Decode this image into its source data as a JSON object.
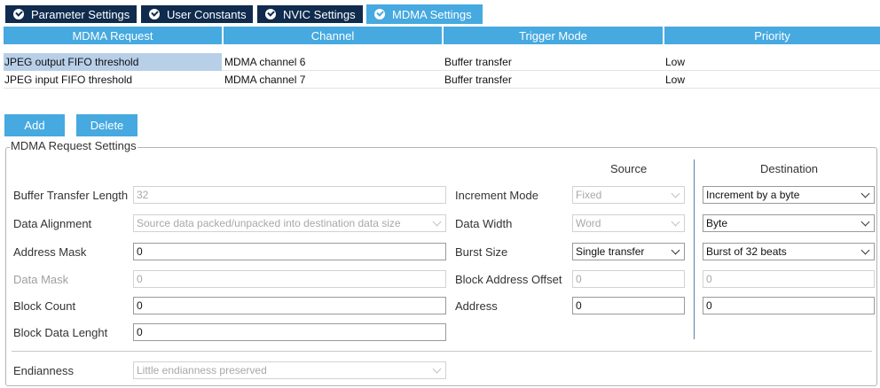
{
  "tabs": [
    {
      "label": "Parameter Settings"
    },
    {
      "label": "User Constants"
    },
    {
      "label": "NVIC Settings"
    },
    {
      "label": "MDMA Settings"
    }
  ],
  "table": {
    "headers": [
      "MDMA Request",
      "Channel",
      "Trigger Mode",
      "Priority"
    ],
    "rows": [
      {
        "request": "JPEG output FIFO threshold",
        "channel": "MDMA channel 6",
        "trigger": "Buffer transfer",
        "priority": "Low"
      },
      {
        "request": "JPEG input FIFO threshold",
        "channel": "MDMA channel 7",
        "trigger": "Buffer transfer",
        "priority": "Low"
      }
    ]
  },
  "buttons": {
    "add": "Add",
    "delete": "Delete"
  },
  "settings": {
    "title": "MDMA Request Settings",
    "source_header": "Source",
    "destination_header": "Destination",
    "buffer_transfer_length": {
      "label": "Buffer Transfer Length",
      "value": "32"
    },
    "data_alignment": {
      "label": "Data Alignment",
      "value": "Source data packed/unpacked into destination data size"
    },
    "address_mask": {
      "label": "Address Mask",
      "value": "0"
    },
    "data_mask": {
      "label": "Data Mask",
      "value": "0"
    },
    "block_count": {
      "label": "Block Count",
      "value": "0"
    },
    "block_data_length": {
      "label": "Block Data Lenght",
      "value": "0"
    },
    "endianness": {
      "label": "Endianness",
      "value": "Little endianness preserved"
    },
    "increment_mode": {
      "label": "Increment Mode",
      "source": "Fixed",
      "destination": "Increment by a byte"
    },
    "data_width": {
      "label": "Data Width",
      "source": "Word",
      "destination": "Byte"
    },
    "burst_size": {
      "label": "Burst Size",
      "source": "Single transfer",
      "destination": "Burst of 32 beats"
    },
    "block_address_offset": {
      "label": "Block Address Offset",
      "source": "0",
      "destination": "0"
    },
    "address": {
      "label": "Address",
      "source": "0",
      "destination": "0"
    }
  }
}
